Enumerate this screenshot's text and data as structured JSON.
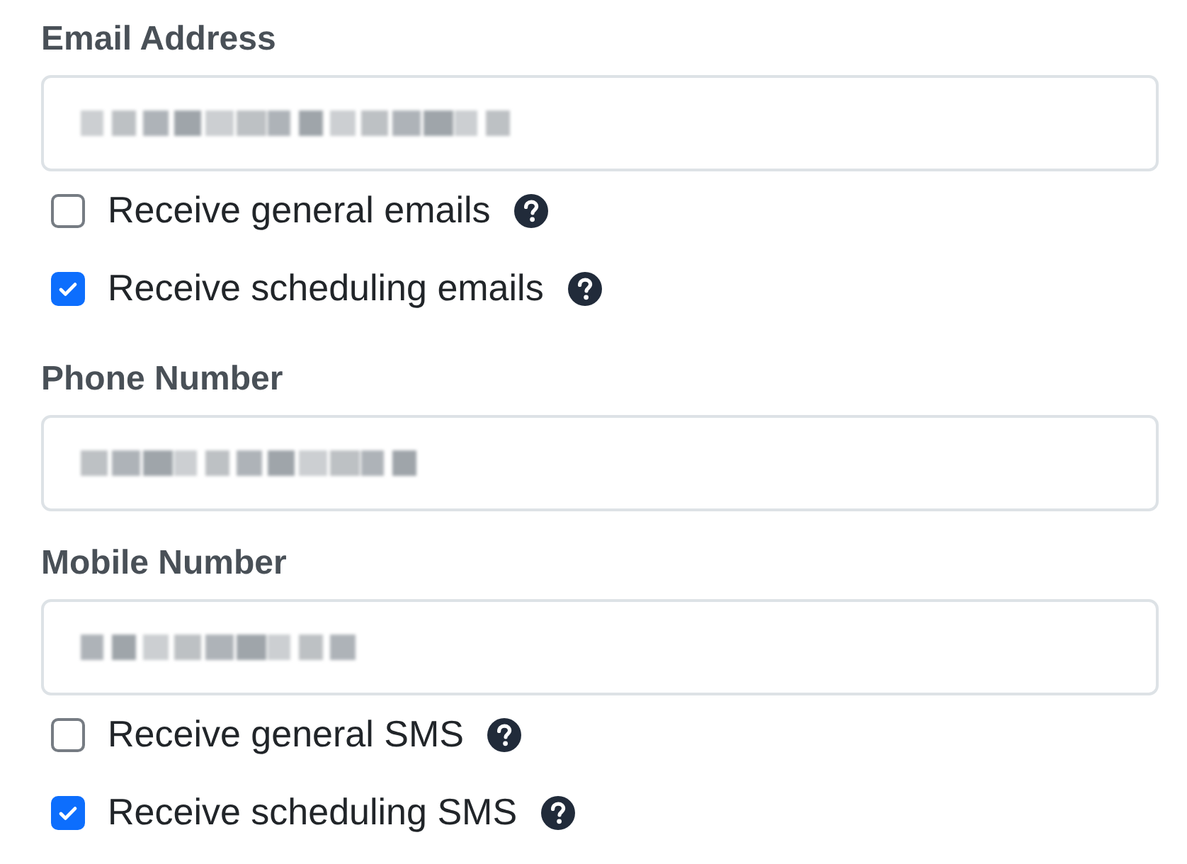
{
  "fields": [
    {
      "label": "Email Address",
      "redacted": true,
      "checkboxes": [
        {
          "label": "Receive general emails",
          "checked": false
        },
        {
          "label": "Receive scheduling emails",
          "checked": true
        }
      ]
    },
    {
      "label": "Phone Number",
      "redacted": true
    },
    {
      "label": "Mobile Number",
      "redacted": true,
      "checkboxes": [
        {
          "label": "Receive general SMS",
          "checked": false
        },
        {
          "label": "Receive scheduling SMS",
          "checked": true
        }
      ]
    }
  ]
}
